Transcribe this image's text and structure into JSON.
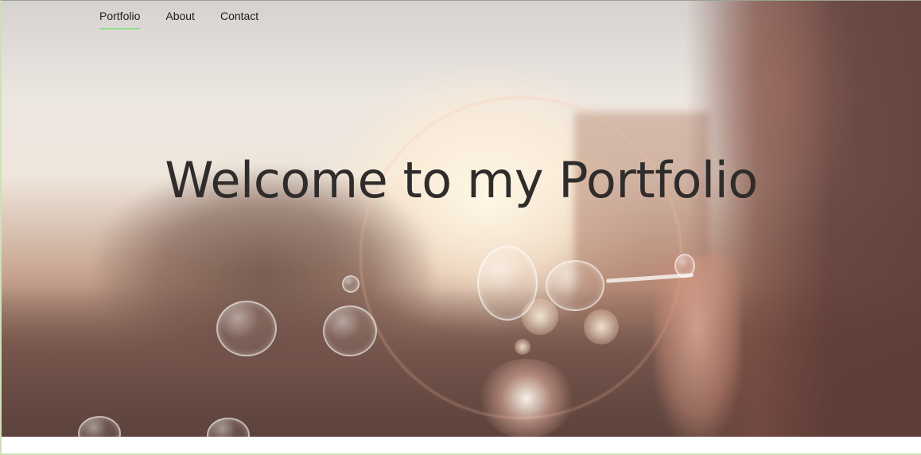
{
  "nav": {
    "items": [
      {
        "label": "Portfolio",
        "active": true
      },
      {
        "label": "About",
        "active": false
      },
      {
        "label": "Contact",
        "active": false
      }
    ],
    "active_underline_color": "#8fde8a"
  },
  "hero": {
    "title": "Welcome to my Portfolio",
    "background": "photo-woman-blowing-bubbles-sunset"
  }
}
